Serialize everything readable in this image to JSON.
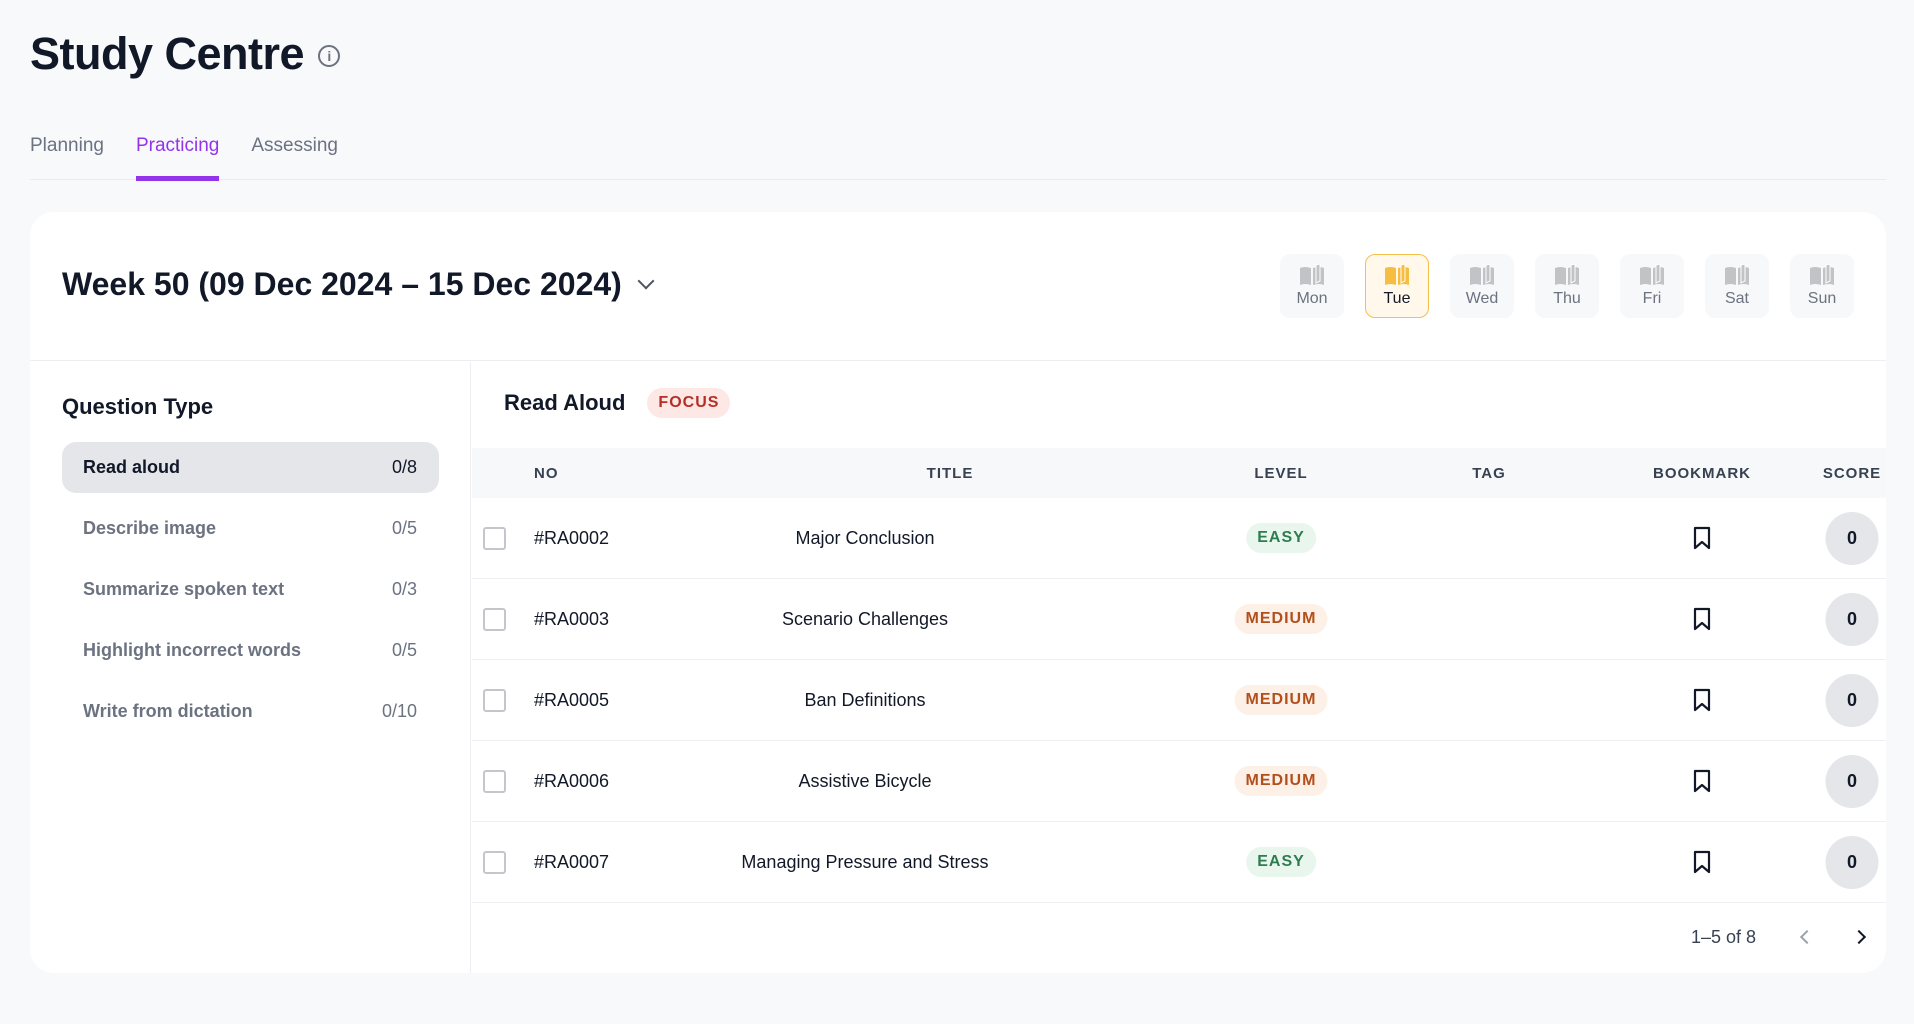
{
  "header": {
    "title": "Study Centre",
    "info_icon": "info-icon"
  },
  "tabs": [
    {
      "label": "Planning"
    },
    {
      "label": "Practicing",
      "active": true
    },
    {
      "label": "Assessing"
    }
  ],
  "week": {
    "label": "Week 50 (09 Dec 2024 – 15 Dec 2024)",
    "selected_day": "Tue"
  },
  "days": [
    {
      "label": "Mon"
    },
    {
      "label": "Tue"
    },
    {
      "label": "Wed"
    },
    {
      "label": "Thu"
    },
    {
      "label": "Fri"
    },
    {
      "label": "Sat"
    },
    {
      "label": "Sun"
    }
  ],
  "sidebar": {
    "title": "Question Type",
    "items": [
      {
        "label": "Read aloud",
        "count": "0/8"
      },
      {
        "label": "Describe image",
        "count": "0/5"
      },
      {
        "label": "Summarize spoken text",
        "count": "0/3"
      },
      {
        "label": "Highlight incorrect words",
        "count": "0/5"
      },
      {
        "label": "Write from dictation",
        "count": "0/10"
      }
    ]
  },
  "main": {
    "title": "Read Aloud",
    "badge": "FOCUS",
    "columns": [
      "NO",
      "TITLE",
      "LEVEL",
      "TAG",
      "BOOKMARK",
      "SCORE"
    ],
    "rows": [
      {
        "no": "#RA0002",
        "title": "Major Conclusion",
        "level": "EASY",
        "tag": "",
        "score": "0"
      },
      {
        "no": "#RA0003",
        "title": "Scenario Challenges",
        "level": "MEDIUM",
        "tag": "",
        "score": "0"
      },
      {
        "no": "#RA0005",
        "title": "Ban Definitions",
        "level": "MEDIUM",
        "tag": "",
        "score": "0"
      },
      {
        "no": "#RA0006",
        "title": "Assistive Bicycle",
        "level": "MEDIUM",
        "tag": "",
        "score": "0"
      },
      {
        "no": "#RA0007",
        "title": "Managing Pressure and Stress",
        "level": "EASY",
        "tag": "",
        "score": "0"
      }
    ],
    "pagination": "1–5 of 8"
  },
  "colors": {
    "accent": "#9333ea",
    "selected_day": "#f5c04a",
    "easy": "#2f7d4f",
    "medium": "#b24f1c",
    "focus": "#b42f26"
  }
}
